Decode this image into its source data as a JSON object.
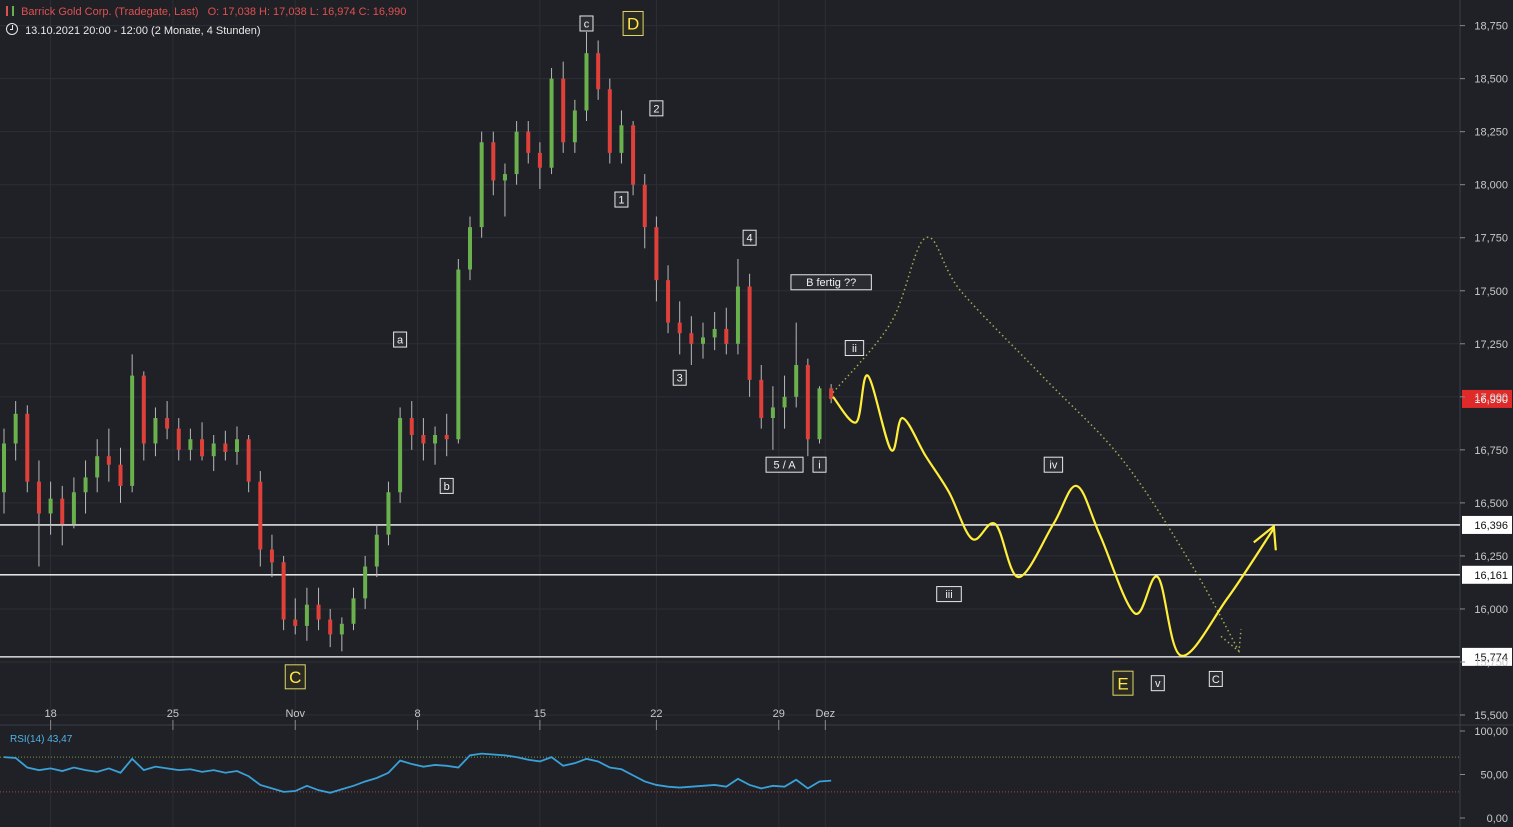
{
  "header": {
    "title": "Barrick Gold Corp. (Tradegate, Last)",
    "ohlc": "O: 17,038  H: 17,038  L: 16,974  C: 16,990",
    "range": "13.10.2021 20:00 - 12:00   (2 Monate, 4 Stunden)"
  },
  "colors": {
    "background": "#1f2126",
    "grid": "#2c2f36",
    "up": "#6ab04c",
    "down": "#e0403a",
    "projection": "#ffee3a",
    "alternative": "#9ab050",
    "rsi": "#3aa0d8",
    "price_tag": "#e02a2a"
  },
  "rsi": {
    "label": "RSI(14)  43,47",
    "ticks": [
      "100,00",
      "50,00",
      "0,00"
    ],
    "upper": 70,
    "lower": 30
  },
  "chart_data": {
    "type": "candlestick",
    "ylim": [
      15.5,
      18.8
    ],
    "y_ticks": [
      "15,500",
      "15,750",
      "16,000",
      "16,250",
      "16,500",
      "16,750",
      "17,000",
      "17,250",
      "17,500",
      "17,750",
      "18,000",
      "18,250",
      "18,500",
      "18,750"
    ],
    "x_ticks": [
      "18",
      "25",
      "Nov",
      "8",
      "15",
      "22",
      "29",
      "Dez"
    ],
    "last_price": {
      "value": 16.99,
      "label": "16,990"
    },
    "levels": [
      {
        "value": 16.396,
        "label": "16,396"
      },
      {
        "value": 16.161,
        "label": "16,161"
      },
      {
        "value": 15.774,
        "label": "15,774"
      }
    ],
    "series": [
      {
        "type": "candles",
        "ohlc": [
          [
            16.55,
            16.85,
            16.45,
            16.78
          ],
          [
            16.78,
            16.98,
            16.7,
            16.92
          ],
          [
            16.92,
            16.96,
            16.55,
            16.6
          ],
          [
            16.6,
            16.7,
            16.2,
            16.45
          ],
          [
            16.45,
            16.6,
            16.35,
            16.52
          ],
          [
            16.52,
            16.58,
            16.3,
            16.4
          ],
          [
            16.4,
            16.62,
            16.38,
            16.55
          ],
          [
            16.55,
            16.7,
            16.45,
            16.62
          ],
          [
            16.62,
            16.8,
            16.55,
            16.72
          ],
          [
            16.72,
            16.85,
            16.6,
            16.68
          ],
          [
            16.68,
            16.76,
            16.5,
            16.58
          ],
          [
            16.58,
            17.2,
            16.55,
            17.1
          ],
          [
            17.1,
            17.12,
            16.7,
            16.78
          ],
          [
            16.78,
            16.95,
            16.72,
            16.9
          ],
          [
            16.9,
            16.98,
            16.8,
            16.85
          ],
          [
            16.85,
            16.9,
            16.7,
            16.75
          ],
          [
            16.75,
            16.85,
            16.7,
            16.8
          ],
          [
            16.8,
            16.88,
            16.7,
            16.72
          ],
          [
            16.72,
            16.82,
            16.65,
            16.78
          ],
          [
            16.78,
            16.84,
            16.7,
            16.74
          ],
          [
            16.74,
            16.86,
            16.68,
            16.8
          ],
          [
            16.8,
            16.82,
            16.55,
            16.6
          ],
          [
            16.6,
            16.65,
            16.2,
            16.28
          ],
          [
            16.28,
            16.35,
            16.15,
            16.22
          ],
          [
            16.22,
            16.25,
            15.9,
            15.95
          ],
          [
            15.95,
            16.05,
            15.88,
            15.92
          ],
          [
            15.92,
            16.1,
            15.85,
            16.02
          ],
          [
            16.02,
            16.1,
            15.9,
            15.95
          ],
          [
            15.95,
            16.0,
            15.82,
            15.88
          ],
          [
            15.88,
            15.96,
            15.8,
            15.93
          ],
          [
            15.93,
            16.1,
            15.9,
            16.05
          ],
          [
            16.05,
            16.25,
            16.0,
            16.2
          ],
          [
            16.2,
            16.4,
            16.15,
            16.35
          ],
          [
            16.35,
            16.6,
            16.3,
            16.55
          ],
          [
            16.55,
            16.95,
            16.5,
            16.9
          ],
          [
            16.9,
            16.98,
            16.75,
            16.82
          ],
          [
            16.82,
            16.9,
            16.7,
            16.78
          ],
          [
            16.78,
            16.86,
            16.68,
            16.82
          ],
          [
            16.82,
            16.92,
            16.72,
            16.8
          ],
          [
            16.8,
            17.65,
            16.78,
            17.6
          ],
          [
            17.6,
            17.85,
            17.55,
            17.8
          ],
          [
            17.8,
            18.25,
            17.75,
            18.2
          ],
          [
            18.2,
            18.25,
            17.95,
            18.02
          ],
          [
            18.02,
            18.1,
            17.85,
            18.05
          ],
          [
            18.05,
            18.3,
            18.0,
            18.25
          ],
          [
            18.25,
            18.3,
            18.1,
            18.15
          ],
          [
            18.15,
            18.2,
            17.98,
            18.08
          ],
          [
            18.08,
            18.55,
            18.05,
            18.5
          ],
          [
            18.5,
            18.58,
            18.15,
            18.2
          ],
          [
            18.2,
            18.4,
            18.15,
            18.35
          ],
          [
            18.35,
            18.72,
            18.3,
            18.62
          ],
          [
            18.62,
            18.68,
            18.4,
            18.45
          ],
          [
            18.45,
            18.5,
            18.1,
            18.15
          ],
          [
            18.15,
            18.35,
            18.1,
            18.28
          ],
          [
            18.28,
            18.3,
            17.95,
            18.0
          ],
          [
            18.0,
            18.05,
            17.7,
            17.8
          ],
          [
            17.8,
            17.85,
            17.45,
            17.55
          ],
          [
            17.55,
            17.62,
            17.3,
            17.35
          ],
          [
            17.35,
            17.45,
            17.2,
            17.3
          ],
          [
            17.3,
            17.38,
            17.15,
            17.25
          ],
          [
            17.25,
            17.35,
            17.18,
            17.28
          ],
          [
            17.28,
            17.4,
            17.22,
            17.32
          ],
          [
            17.32,
            17.42,
            17.2,
            17.25
          ],
          [
            17.25,
            17.65,
            17.2,
            17.52
          ],
          [
            17.52,
            17.58,
            17.0,
            17.08
          ],
          [
            17.08,
            17.15,
            16.85,
            16.9
          ],
          [
            16.9,
            17.05,
            16.75,
            16.95
          ],
          [
            16.95,
            17.1,
            16.85,
            17.0
          ],
          [
            17.0,
            17.35,
            16.95,
            17.15
          ],
          [
            17.15,
            17.18,
            16.72,
            16.8
          ],
          [
            16.8,
            17.05,
            16.78,
            17.04
          ],
          [
            17.04,
            17.06,
            16.97,
            16.99
          ]
        ]
      },
      {
        "type": "rsi",
        "values": [
          70,
          69,
          58,
          55,
          57,
          54,
          58,
          55,
          53,
          57,
          52,
          68,
          55,
          59,
          57,
          55,
          56,
          53,
          55,
          52,
          54,
          48,
          38,
          34,
          30,
          31,
          37,
          32,
          29,
          33,
          37,
          42,
          46,
          52,
          66,
          62,
          59,
          61,
          60,
          58,
          72,
          74,
          73,
          72,
          70,
          67,
          65,
          70,
          60,
          63,
          68,
          65,
          58,
          56,
          49,
          42,
          38,
          36,
          35,
          36,
          37,
          38,
          36,
          45,
          38,
          34,
          37,
          36,
          44,
          34,
          42,
          43
        ]
      },
      {
        "type": "projection",
        "name": "yellow",
        "points": [
          [
            0,
            17.0
          ],
          [
            2,
            16.88
          ],
          [
            3,
            17.1
          ],
          [
            5,
            16.75
          ],
          [
            6,
            16.9
          ],
          [
            8,
            16.72
          ],
          [
            10,
            16.55
          ],
          [
            12,
            16.33
          ],
          [
            14,
            16.4
          ],
          [
            16,
            16.15
          ],
          [
            19,
            16.4
          ],
          [
            21,
            16.58
          ],
          [
            23,
            16.35
          ],
          [
            26,
            15.98
          ],
          [
            28,
            16.15
          ],
          [
            30,
            15.78
          ],
          [
            34,
            16.05
          ],
          [
            38,
            16.38
          ]
        ]
      },
      {
        "type": "projection",
        "name": "alternative",
        "points": [
          [
            0,
            17.02
          ],
          [
            5,
            17.35
          ],
          [
            8,
            17.75
          ],
          [
            11,
            17.5
          ],
          [
            18,
            17.1
          ],
          [
            25,
            16.7
          ],
          [
            31,
            16.2
          ],
          [
            35,
            15.8
          ]
        ]
      }
    ],
    "annotations": [
      {
        "text": "c",
        "x_bar": 50,
        "price": 18.76,
        "style": "box"
      },
      {
        "text": "D",
        "x_bar": 54,
        "price": 18.76,
        "style": "yellow"
      },
      {
        "text": "2",
        "x_bar": 56,
        "price": 18.36,
        "style": "box"
      },
      {
        "text": "1",
        "x_bar": 53,
        "price": 17.93,
        "style": "box"
      },
      {
        "text": "4",
        "x_bar": 64,
        "price": 17.75,
        "style": "box"
      },
      {
        "text": "B fertig  ??",
        "x_bar": 71,
        "price": 17.54,
        "style": "box"
      },
      {
        "text": "a",
        "x_bar": 34,
        "price": 17.27,
        "style": "box"
      },
      {
        "text": "ii",
        "x_bar": 73,
        "price": 17.23,
        "style": "box"
      },
      {
        "text": "3",
        "x_bar": 58,
        "price": 17.09,
        "style": "box"
      },
      {
        "text": "5 / A",
        "x_bar": 67,
        "price": 16.68,
        "style": "box"
      },
      {
        "text": "i",
        "x_bar": 70,
        "price": 16.68,
        "style": "box"
      },
      {
        "text": "b",
        "x_bar": 38,
        "price": 16.58,
        "style": "box"
      },
      {
        "text": "iv",
        "x_proj": 19,
        "price": 16.68,
        "style": "box"
      },
      {
        "text": "iii",
        "x_proj": 10,
        "price": 16.07,
        "style": "box"
      },
      {
        "text": "C",
        "x_bar": 25,
        "price": 15.68,
        "style": "yellow"
      },
      {
        "text": "E",
        "x_proj": 25,
        "price": 15.65,
        "style": "yellow"
      },
      {
        "text": "v",
        "x_proj": 28,
        "price": 15.65,
        "style": "box"
      },
      {
        "text": "C",
        "x_proj": 33,
        "price": 15.67,
        "style": "box"
      }
    ]
  }
}
